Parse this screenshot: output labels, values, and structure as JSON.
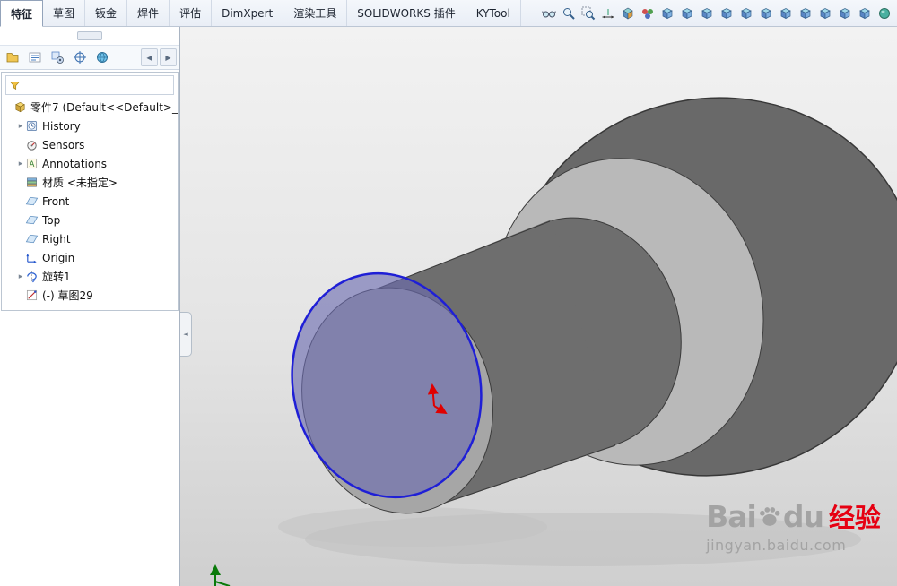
{
  "ribbon": {
    "tabs": [
      {
        "label": "特征",
        "active": true
      },
      {
        "label": "草图"
      },
      {
        "label": "钣金"
      },
      {
        "label": "焊件"
      },
      {
        "label": "评估"
      },
      {
        "label": "DimXpert"
      },
      {
        "label": "渲染工具"
      },
      {
        "label": "SOLIDWORKS 插件"
      },
      {
        "label": "KYTool"
      }
    ]
  },
  "view_toolbar": {
    "icons": [
      "measure-icon",
      "zoom-to-fit-icon",
      "zoom-area-icon",
      "dimension-icon",
      "section-view-icon",
      "appearance-icon",
      "view-front-icon",
      "view-back-icon",
      "view-left-icon",
      "view-right-icon",
      "view-top-icon",
      "view-bottom-icon",
      "view-isometric-icon",
      "view-dimetric-icon",
      "view-trimetric-icon",
      "view-normal-icon",
      "view-orientation-icon",
      "shaded-view-icon"
    ]
  },
  "panel": {
    "toolbar": {
      "icons": [
        "feature-tree-icon",
        "property-manager-icon",
        "configuration-icon",
        "dimxpert-manager-icon",
        "display-manager-icon"
      ],
      "prev": "◀",
      "next": "▶"
    },
    "filter": {
      "placeholder": ""
    },
    "tree": {
      "items": [
        {
          "label": "零件7 (Default<<Default>_",
          "icon": "part-icon",
          "expand": ""
        },
        {
          "label": "History",
          "icon": "history-icon",
          "expand": "▸"
        },
        {
          "label": "Sensors",
          "icon": "sensors-icon",
          "expand": ""
        },
        {
          "label": "Annotations",
          "icon": "annotations-icon",
          "expand": "▸"
        },
        {
          "label": "材质 <未指定>",
          "icon": "material-icon",
          "expand": ""
        },
        {
          "label": "Front",
          "icon": "plane-icon",
          "expand": ""
        },
        {
          "label": "Top",
          "icon": "plane-icon",
          "expand": ""
        },
        {
          "label": "Right",
          "icon": "plane-icon",
          "expand": ""
        },
        {
          "label": "Origin",
          "icon": "origin-icon",
          "expand": ""
        },
        {
          "label": "旋转1",
          "icon": "revolve-icon",
          "expand": "▸"
        },
        {
          "label": "(-) 草图29",
          "icon": "sketch-icon",
          "expand": ""
        }
      ]
    },
    "collapse_glyph": "◄",
    "colors": {
      "selected_face_fill": "#6b6bb0",
      "selected_face_edge": "#1f1fd6",
      "sketch_arrow": "#e00000",
      "triad": "#0a7a0a"
    }
  },
  "watermark": {
    "brand_prefix": "Bai",
    "brand_suffix": "du",
    "brand_cn": "经验",
    "url": "jingyan.baidu.com"
  }
}
